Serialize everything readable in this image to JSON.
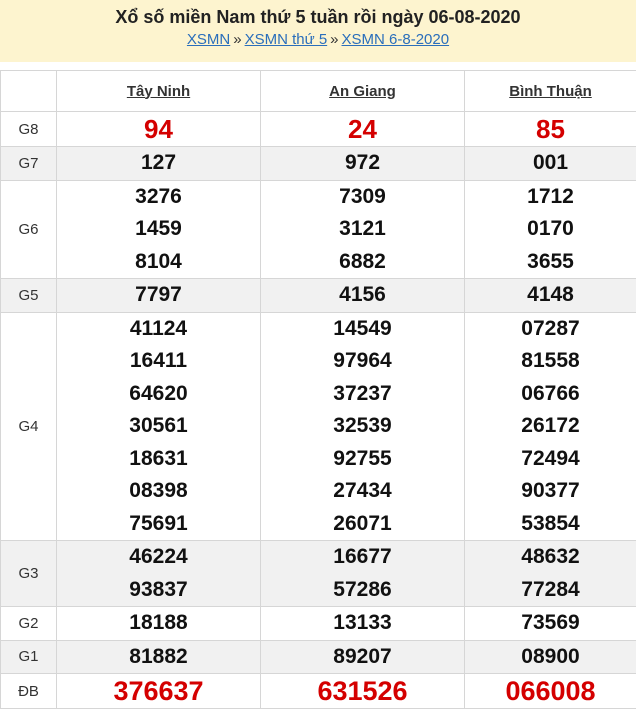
{
  "header": {
    "title": "Xổ số miền Nam thứ 5 tuần rồi ngày 06-08-2020",
    "breadcrumb": [
      {
        "label": "XSMN"
      },
      {
        "label": "XSMN thứ 5"
      },
      {
        "label": "XSMN 6-8-2020"
      }
    ],
    "separator": "»"
  },
  "provinces": [
    "Tây Ninh",
    "An Giang",
    "Bình Thuận"
  ],
  "prizes": [
    {
      "label": "G8",
      "highlight": true,
      "values": [
        [
          "94"
        ],
        [
          "24"
        ],
        [
          "85"
        ]
      ]
    },
    {
      "label": "G7",
      "values": [
        [
          "127"
        ],
        [
          "972"
        ],
        [
          "001"
        ]
      ]
    },
    {
      "label": "G6",
      "values": [
        [
          "3276",
          "1459",
          "8104"
        ],
        [
          "7309",
          "3121",
          "6882"
        ],
        [
          "1712",
          "0170",
          "3655"
        ]
      ]
    },
    {
      "label": "G5",
      "values": [
        [
          "7797"
        ],
        [
          "4156"
        ],
        [
          "4148"
        ]
      ]
    },
    {
      "label": "G4",
      "values": [
        [
          "41124",
          "16411",
          "64620",
          "30561",
          "18631",
          "08398",
          "75691"
        ],
        [
          "14549",
          "97964",
          "37237",
          "32539",
          "92755",
          "27434",
          "26071"
        ],
        [
          "07287",
          "81558",
          "06766",
          "26172",
          "72494",
          "90377",
          "53854"
        ]
      ]
    },
    {
      "label": "G3",
      "values": [
        [
          "46224",
          "93837"
        ],
        [
          "16677",
          "57286"
        ],
        [
          "48632",
          "77284"
        ]
      ]
    },
    {
      "label": "G2",
      "values": [
        [
          "18188"
        ],
        [
          "13133"
        ],
        [
          "73569"
        ]
      ]
    },
    {
      "label": "G1",
      "values": [
        [
          "81882"
        ],
        [
          "89207"
        ],
        [
          "08900"
        ]
      ]
    },
    {
      "label": "ĐB",
      "highlight": true,
      "values": [
        [
          "376637"
        ],
        [
          "631526"
        ],
        [
          "066008"
        ]
      ]
    }
  ],
  "colors": {
    "highlight": "#d40000",
    "header_bg": "#fdf4cf",
    "shade": "#f1f1f1",
    "link": "#2a6ebb"
  }
}
